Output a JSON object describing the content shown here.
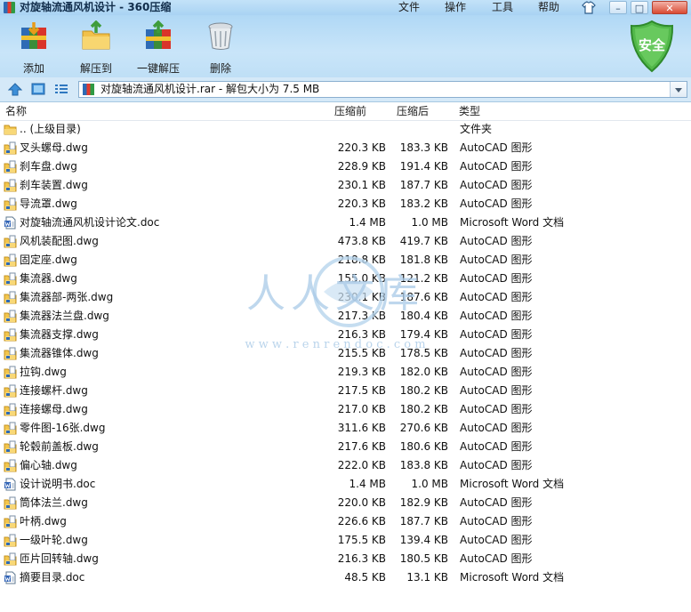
{
  "window": {
    "title": "对旋轴流通风机设计 - 360压缩",
    "menus": [
      "文件",
      "操作",
      "工具",
      "帮助"
    ],
    "controls": [
      "–",
      "□",
      "✕"
    ]
  },
  "toolbar": {
    "buttons": [
      "添加",
      "解压到",
      "一键解压",
      "删除"
    ],
    "security_badge": "安全"
  },
  "address": {
    "path": "对旋轴流通风机设计.rar - 解包大小为 7.5 MB"
  },
  "columns": [
    "名称",
    "压缩前",
    "压缩后",
    "类型"
  ],
  "files": [
    {
      "name": ".. (上级目录)",
      "before": "",
      "after": "",
      "type": "文件夹",
      "icon": "folder-icon"
    },
    {
      "name": "叉头螺母.dwg",
      "before": "220.3 KB",
      "after": "183.3 KB",
      "type": "AutoCAD 图形",
      "icon": "dwg-file-icon"
    },
    {
      "name": "刹车盘.dwg",
      "before": "228.9 KB",
      "after": "191.4 KB",
      "type": "AutoCAD 图形",
      "icon": "dwg-file-icon"
    },
    {
      "name": "刹车装置.dwg",
      "before": "230.1 KB",
      "after": "187.7 KB",
      "type": "AutoCAD 图形",
      "icon": "dwg-file-icon"
    },
    {
      "name": "导流罩.dwg",
      "before": "220.3 KB",
      "after": "183.2 KB",
      "type": "AutoCAD 图形",
      "icon": "dwg-file-icon"
    },
    {
      "name": "对旋轴流通风机设计论文.doc",
      "before": "1.4 MB",
      "after": "1.0 MB",
      "type": "Microsoft Word 文档",
      "icon": "doc-file-icon"
    },
    {
      "name": "风机装配图.dwg",
      "before": "473.8 KB",
      "after": "419.7 KB",
      "type": "AutoCAD 图形",
      "icon": "dwg-file-icon"
    },
    {
      "name": "固定座.dwg",
      "before": "218.8 KB",
      "after": "181.8 KB",
      "type": "AutoCAD 图形",
      "icon": "dwg-file-icon"
    },
    {
      "name": "集流器.dwg",
      "before": "155.0 KB",
      "after": "121.2 KB",
      "type": "AutoCAD 图形",
      "icon": "dwg-file-icon"
    },
    {
      "name": "集流器部-两张.dwg",
      "before": "230.1 KB",
      "after": "187.6 KB",
      "type": "AutoCAD 图形",
      "icon": "dwg-file-icon"
    },
    {
      "name": "集流器法兰盘.dwg",
      "before": "217.3 KB",
      "after": "180.4 KB",
      "type": "AutoCAD 图形",
      "icon": "dwg-file-icon"
    },
    {
      "name": "集流器支撑.dwg",
      "before": "216.3 KB",
      "after": "179.4 KB",
      "type": "AutoCAD 图形",
      "icon": "dwg-file-icon"
    },
    {
      "name": "集流器锥体.dwg",
      "before": "215.5 KB",
      "after": "178.5 KB",
      "type": "AutoCAD 图形",
      "icon": "dwg-file-icon"
    },
    {
      "name": "拉钩.dwg",
      "before": "219.3 KB",
      "after": "182.0 KB",
      "type": "AutoCAD 图形",
      "icon": "dwg-file-icon"
    },
    {
      "name": "连接螺杆.dwg",
      "before": "217.5 KB",
      "after": "180.2 KB",
      "type": "AutoCAD 图形",
      "icon": "dwg-file-icon"
    },
    {
      "name": "连接螺母.dwg",
      "before": "217.0 KB",
      "after": "180.2 KB",
      "type": "AutoCAD 图形",
      "icon": "dwg-file-icon"
    },
    {
      "name": "零件图-16张.dwg",
      "before": "311.6 KB",
      "after": "270.6 KB",
      "type": "AutoCAD 图形",
      "icon": "dwg-file-icon"
    },
    {
      "name": "轮毂前盖板.dwg",
      "before": "217.6 KB",
      "after": "180.6 KB",
      "type": "AutoCAD 图形",
      "icon": "dwg-file-icon"
    },
    {
      "name": "偏心轴.dwg",
      "before": "222.0 KB",
      "after": "183.8 KB",
      "type": "AutoCAD 图形",
      "icon": "dwg-file-icon"
    },
    {
      "name": "设计说明书.doc",
      "before": "1.4 MB",
      "after": "1.0 MB",
      "type": "Microsoft Word 文档",
      "icon": "doc-file-icon"
    },
    {
      "name": "筒体法兰.dwg",
      "before": "220.0 KB",
      "after": "182.9 KB",
      "type": "AutoCAD 图形",
      "icon": "dwg-file-icon"
    },
    {
      "name": "叶柄.dwg",
      "before": "226.6 KB",
      "after": "187.7 KB",
      "type": "AutoCAD 图形",
      "icon": "dwg-file-icon"
    },
    {
      "name": "一级叶轮.dwg",
      "before": "175.5 KB",
      "after": "139.4 KB",
      "type": "AutoCAD 图形",
      "icon": "dwg-file-icon"
    },
    {
      "name": "匝片回转轴.dwg",
      "before": "216.3 KB",
      "after": "180.5 KB",
      "type": "AutoCAD 图形",
      "icon": "dwg-file-icon"
    },
    {
      "name": "摘要目录.doc",
      "before": "48.5 KB",
      "after": "13.1 KB",
      "type": "Microsoft Word 文档",
      "icon": "doc-file-icon"
    }
  ],
  "watermark": {
    "text": "人人文库",
    "url": "w w w . r e n r e n d o c . c o m"
  }
}
